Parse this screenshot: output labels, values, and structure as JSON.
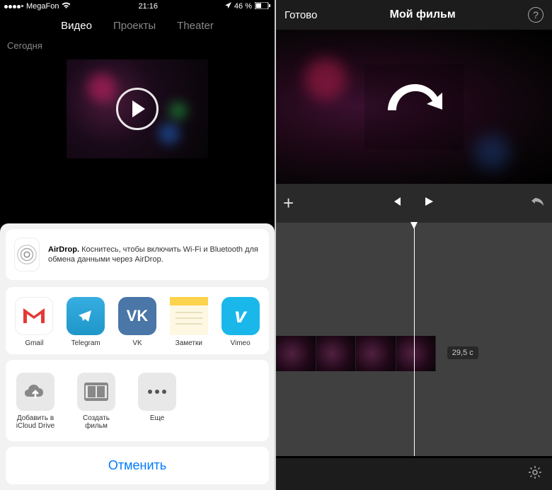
{
  "left": {
    "statusBar": {
      "carrier": "MegaFon",
      "time": "21:16",
      "battery": "46 %"
    },
    "tabs": {
      "video": "Видео",
      "projects": "Проекты",
      "theater": "Theater"
    },
    "sectionLabel": "Сегодня",
    "airdrop": {
      "title": "AirDrop.",
      "desc": "Коснитесь, чтобы включить Wi-Fi и Bluetooth для обмена данными через AirDrop."
    },
    "apps": [
      {
        "label": "Gmail"
      },
      {
        "label": "Telegram"
      },
      {
        "label": "VK"
      },
      {
        "label": "Заметки"
      },
      {
        "label": "Vimeo"
      }
    ],
    "actions": [
      {
        "label": "Добавить в iCloud Drive"
      },
      {
        "label": "Создать фильм"
      },
      {
        "label": "Еще"
      }
    ],
    "cancel": "Отменить"
  },
  "right": {
    "done": "Готово",
    "title": "Мой фильм",
    "time": "29,5 с"
  }
}
